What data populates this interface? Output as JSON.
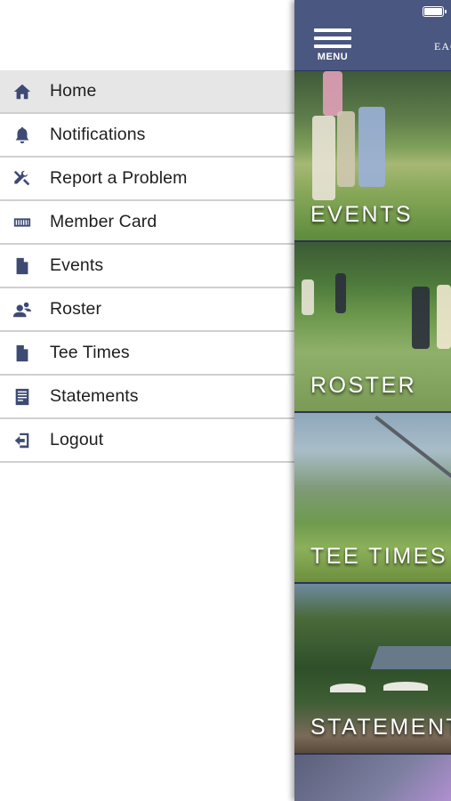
{
  "drawer": {
    "items": [
      {
        "label": "Home",
        "icon": "home-icon",
        "active": true
      },
      {
        "label": "Notifications",
        "icon": "bell-icon",
        "active": false
      },
      {
        "label": "Report a Problem",
        "icon": "tools-icon",
        "active": false
      },
      {
        "label": "Member Card",
        "icon": "card-icon",
        "active": false
      },
      {
        "label": "Events",
        "icon": "document-icon",
        "active": false
      },
      {
        "label": "Roster",
        "icon": "people-icon",
        "active": false
      },
      {
        "label": "Tee Times",
        "icon": "document-icon",
        "active": false
      },
      {
        "label": "Statements",
        "icon": "statement-icon",
        "active": false
      },
      {
        "label": "Logout",
        "icon": "logout-icon",
        "active": false
      }
    ]
  },
  "topbar": {
    "menu_label": "MENU",
    "brand_partial": "EAG"
  },
  "tiles": [
    {
      "label": "EVENTS"
    },
    {
      "label": "ROSTER"
    },
    {
      "label": "TEE TIMES"
    },
    {
      "label": "STATEMENTS"
    }
  ],
  "colors": {
    "icon": "#3d4b73",
    "topbar": "#4a5780",
    "active_row": "#e6e6e6"
  }
}
